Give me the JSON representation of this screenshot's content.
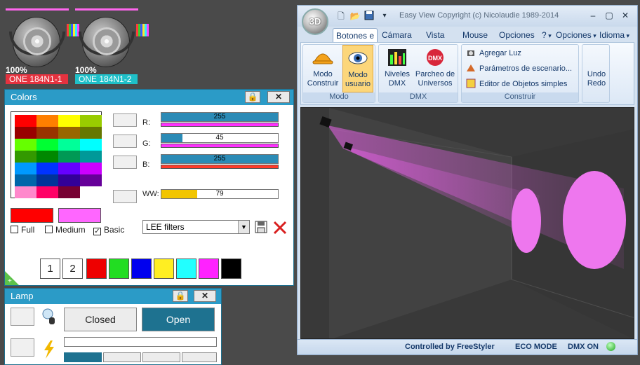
{
  "fixtures": [
    {
      "level": "100%",
      "name": "ONE 184N1-1",
      "name_bg": "#e5323f"
    },
    {
      "level": "100%",
      "name": "ONE 184N1-2",
      "name_bg": "#1fc0c8"
    }
  ],
  "colors_panel": {
    "title": "Colors",
    "channels": [
      {
        "label": "R:",
        "value": "255",
        "level": 1.0,
        "bar_color": "#ff30ff"
      },
      {
        "label": "G:",
        "value": "45",
        "level": 0.18,
        "bar_color": "#ff30ff"
      },
      {
        "label": "B:",
        "value": "255",
        "level": 1.0,
        "bar_color": "#ff3b2a"
      },
      {
        "label": "WW:",
        "value": "79",
        "level": 0.31,
        "bar_color": "#f2c500"
      }
    ],
    "swatches": [
      "#ff0000",
      "#ff7f00",
      "#ffff00",
      "#99cc00",
      "#990000",
      "#993300",
      "#996600",
      "#667700",
      "#66ff00",
      "#00ff33",
      "#00ff99",
      "#00ffff",
      "#339900",
      "#008800",
      "#009955",
      "#009999",
      "#0099ff",
      "#0033ff",
      "#6600ff",
      "#cc00ff",
      "#0066aa",
      "#003399",
      "#330099",
      "#660099",
      "#ff88cc",
      "#ff0066",
      "#770033",
      "#ffffff"
    ],
    "current_color": "#ff0000",
    "mixed_color": "#ff66ff",
    "checks": [
      {
        "label": "Full",
        "checked": false
      },
      {
        "label": "Medium",
        "checked": false
      },
      {
        "label": "Basic",
        "checked": true
      }
    ],
    "filter_select": "LEE filters",
    "preset_numbers": [
      "1",
      "2"
    ],
    "preset_colors": [
      "#ee0000",
      "#22dd22",
      "#0000ee",
      "#ffee22",
      "#22ffff",
      "#ff22ff",
      "#000000"
    ]
  },
  "lamp_panel": {
    "title": "Lamp",
    "closed_label": "Closed",
    "open_label": "Open"
  },
  "easyview": {
    "title": "Easy View   Copyright (c) Nicolaudie 1989-2014",
    "orb_label": "3D",
    "tabs": [
      "Botones e",
      "Cámara",
      "Vista",
      "Mouse",
      "Opciones",
      "?",
      "Opciones",
      "Idioma"
    ],
    "groups": {
      "modo": {
        "label": "Modo",
        "construir": "Modo\nConstruir",
        "usuario": "Modo\nusuario"
      },
      "dmx": {
        "label": "DMX",
        "niveles": "Niveles\nDMX",
        "parcheo": "Parcheo de\nUniversos"
      },
      "construir": {
        "label": "Construir",
        "items": [
          "Agregar Luz",
          "Parámetros de escenario...",
          "Editor de Objetos simples"
        ]
      },
      "undo": "Undo\nRedo"
    },
    "status": {
      "controlled": "Controlled by FreeStyler",
      "eco": "ECO MODE",
      "dmx": "DMX ON"
    }
  }
}
